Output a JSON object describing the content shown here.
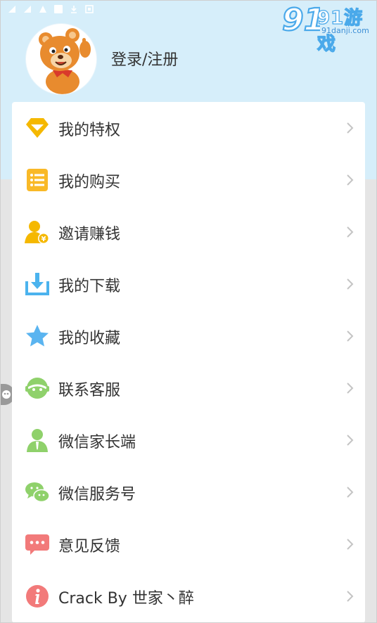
{
  "profile": {
    "login_label": "登录/注册",
    "avatar_icon": "bear-mascot-icon"
  },
  "watermark": {
    "logo_text": "91游戏",
    "domain": "91danji.com"
  },
  "menu": [
    {
      "label": "我的特权",
      "icon": "diamond-icon",
      "color": "#f5b800"
    },
    {
      "label": "我的购买",
      "icon": "list-icon",
      "color": "#f9b927"
    },
    {
      "label": "邀请赚钱",
      "icon": "user-money-icon",
      "color": "#f5b800"
    },
    {
      "label": "我的下载",
      "icon": "download-icon",
      "color": "#4bb3ee"
    },
    {
      "label": "我的收藏",
      "icon": "star-icon",
      "color": "#5ab4f0"
    },
    {
      "label": "联系客服",
      "icon": "customer-service-icon",
      "color": "#8fd16b"
    },
    {
      "label": "微信家长端",
      "icon": "parent-user-icon",
      "color": "#8fd16b"
    },
    {
      "label": "微信服务号",
      "icon": "wechat-icon",
      "color": "#8fd16b"
    },
    {
      "label": "意见反馈",
      "icon": "feedback-chat-icon",
      "color": "#f27a7a"
    },
    {
      "label": "Crack By 世家丶醉",
      "icon": "info-icon",
      "color": "#f27a7a"
    }
  ],
  "colors": {
    "header_bg": "#d6eefa",
    "page_bg": "#e5e5e5",
    "chevron": "#c4c4c4"
  }
}
